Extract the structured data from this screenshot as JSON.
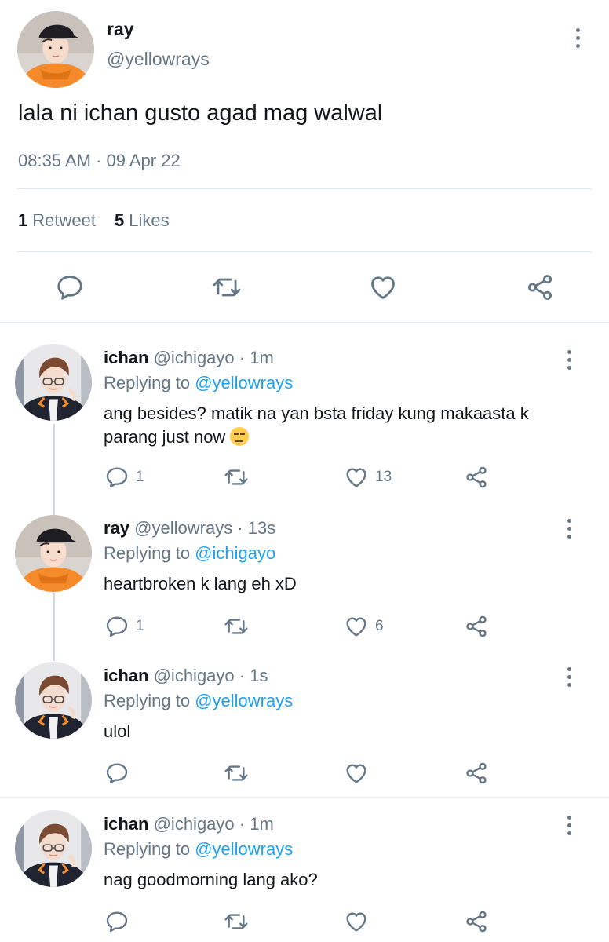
{
  "main_tweet": {
    "name": "ray",
    "handle": "@yellowrays",
    "text": "lala ni ichan gusto agad mag walwal",
    "timestamp": "08:35 AM · 09 Apr 22",
    "retweets_count": "1",
    "retweets_label": "Retweet",
    "likes_count": "5",
    "likes_label": "Likes"
  },
  "replies": [
    {
      "name": "ichan",
      "handle": "@ichigayo",
      "time": "· 1m",
      "replying_prefix": "Replying to",
      "replying_to": "@yellowrays",
      "text_line1": "ang besides? matik na yan bsta friday kung makaasta k",
      "text_line2": "parang just now",
      "reply_count": "1",
      "retweet_count": "",
      "like_count": "13"
    },
    {
      "name": "ray",
      "handle": "@yellowrays",
      "time": "· 13s",
      "replying_prefix": "Replying to",
      "replying_to": "@ichigayo",
      "text_line1": "heartbroken k lang eh xD",
      "reply_count": "1",
      "retweet_count": "",
      "like_count": "6"
    },
    {
      "name": "ichan",
      "handle": "@ichigayo",
      "time": "· 1s",
      "replying_prefix": "Replying to",
      "replying_to": "@yellowrays",
      "text_line1": "ulol",
      "reply_count": "",
      "retweet_count": "",
      "like_count": ""
    },
    {
      "name": "ichan",
      "handle": "@ichigayo",
      "time": "· 1m",
      "replying_prefix": "Replying to",
      "replying_to": "@yellowrays",
      "text_line1": "nag goodmorning lang ako?",
      "reply_count": "",
      "retweet_count": "",
      "like_count": ""
    }
  ],
  "icons": {
    "reply": "reply-icon",
    "retweet": "retweet-icon",
    "like": "heart-icon",
    "share": "share-icon",
    "more": "more-vertical-icon",
    "emoji": "unamused-face-emoji"
  },
  "colors": {
    "text": "#14171a",
    "secondary": "#657786",
    "link": "#1da1f2",
    "divider": "#e1e8ed",
    "thread_line": "#ccd6dd"
  }
}
